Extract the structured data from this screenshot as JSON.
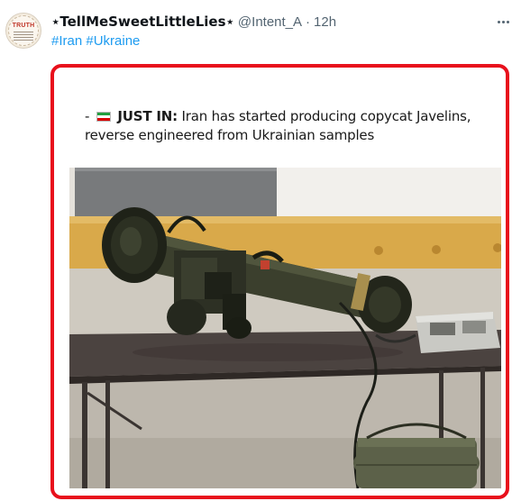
{
  "tweet": {
    "display_name": "⋆TellMeSweetLittleLies⋆",
    "handle": "@Intent_A",
    "separator": "·",
    "time": "12h",
    "hashtags": [
      "#Iran",
      "#Ukraine"
    ],
    "avatar_text": "TRUTH"
  },
  "embedded_post": {
    "prefix": "-",
    "flag_icon": "iran-flag-icon",
    "headline_label": "JUST IN:",
    "body": "Iran has started producing copycat Javelins, reverse engineered from Ukrainian samples"
  },
  "colors": {
    "highlight_border": "#e8101c",
    "link": "#1d9bf0",
    "secondary_text": "#536471"
  },
  "icons": {
    "more": "more-options-icon"
  }
}
